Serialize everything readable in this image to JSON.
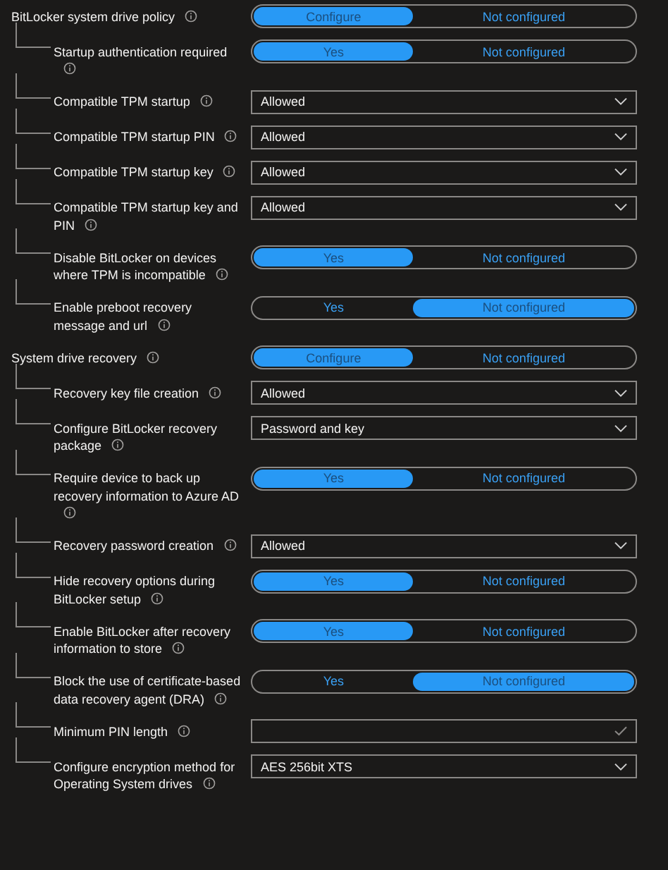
{
  "sections": [
    {
      "label": "BitLocker system drive policy",
      "kind": "toggle",
      "options": [
        {
          "label": "Configure",
          "selected": true
        },
        {
          "label": "Not configured",
          "selected": false
        }
      ],
      "children": [
        {
          "label": "Startup authentication required",
          "kind": "toggle",
          "options": [
            {
              "label": "Yes",
              "selected": true
            },
            {
              "label": "Not configured",
              "selected": false
            }
          ]
        },
        {
          "label": "Compatible TPM startup",
          "kind": "dropdown",
          "value": "Allowed"
        },
        {
          "label": "Compatible TPM startup PIN",
          "kind": "dropdown",
          "value": "Allowed"
        },
        {
          "label": "Compatible TPM startup key",
          "kind": "dropdown",
          "value": "Allowed"
        },
        {
          "label": "Compatible TPM startup key and PIN",
          "kind": "dropdown",
          "value": "Allowed"
        },
        {
          "label": "Disable BitLocker on devices where TPM is incompatible",
          "kind": "toggle",
          "options": [
            {
              "label": "Yes",
              "selected": true
            },
            {
              "label": "Not configured",
              "selected": false
            }
          ]
        },
        {
          "label": "Enable preboot recovery message and url",
          "kind": "toggle",
          "options": [
            {
              "label": "Yes",
              "selected": false
            },
            {
              "label": "Not configured",
              "selected": true
            }
          ]
        }
      ]
    },
    {
      "label": "System drive recovery",
      "kind": "toggle",
      "options": [
        {
          "label": "Configure",
          "selected": true
        },
        {
          "label": "Not configured",
          "selected": false
        }
      ],
      "children": [
        {
          "label": "Recovery key file creation",
          "kind": "dropdown",
          "value": "Allowed"
        },
        {
          "label": "Configure BitLocker recovery package",
          "kind": "dropdown",
          "value": "Password and key"
        },
        {
          "label": "Require device to back up recovery information to Azure AD",
          "kind": "toggle",
          "options": [
            {
              "label": "Yes",
              "selected": true
            },
            {
              "label": "Not configured",
              "selected": false
            }
          ]
        },
        {
          "label": "Recovery password creation",
          "kind": "dropdown",
          "value": "Allowed"
        },
        {
          "label": "Hide recovery options during BitLocker setup",
          "kind": "toggle",
          "options": [
            {
              "label": "Yes",
              "selected": true
            },
            {
              "label": "Not configured",
              "selected": false
            }
          ]
        },
        {
          "label": "Enable BitLocker after recovery information to store",
          "kind": "toggle",
          "options": [
            {
              "label": "Yes",
              "selected": true
            },
            {
              "label": "Not configured",
              "selected": false
            }
          ]
        },
        {
          "label": "Block the use of certificate-based data recovery agent (DRA)",
          "kind": "toggle",
          "options": [
            {
              "label": "Yes",
              "selected": false
            },
            {
              "label": "Not configured",
              "selected": true
            }
          ]
        },
        {
          "label": "Minimum PIN length",
          "kind": "text"
        },
        {
          "label": "Configure encryption method for Operating System drives",
          "kind": "dropdown",
          "value": "AES 256bit XTS"
        }
      ]
    }
  ]
}
